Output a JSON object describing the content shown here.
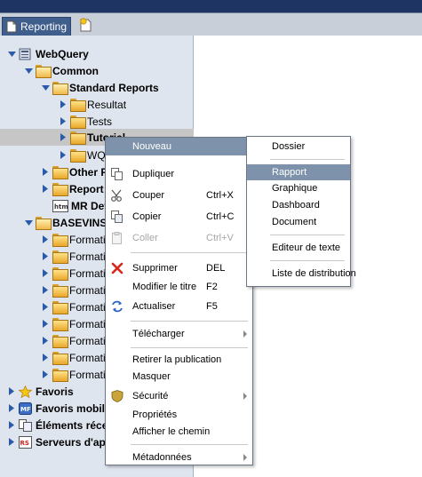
{
  "window": {
    "tab_label": "Reporting"
  },
  "tree": {
    "items": [
      {
        "label": "WebQuery",
        "icon": "webquery-icon"
      },
      {
        "label": "Common",
        "icon": "folder-open-icon"
      },
      {
        "label": "Standard Reports",
        "icon": "folder-open-icon"
      },
      {
        "label": "Resultat",
        "icon": "folder-icon"
      },
      {
        "label": "Tests",
        "icon": "folder-icon"
      },
      {
        "label": "Tutorial",
        "icon": "folder-icon"
      },
      {
        "label": "WQ",
        "icon": "folder-icon"
      },
      {
        "label": "Other R",
        "icon": "folder-icon"
      },
      {
        "label": "Report",
        "icon": "folder-icon"
      },
      {
        "label": "MR Def",
        "icon": "html-file-icon"
      },
      {
        "label": "BASEVINS",
        "icon": "folder-open-icon"
      },
      {
        "label": "Formatio",
        "icon": "folder-icon"
      },
      {
        "label": "Formatio",
        "icon": "folder-icon"
      },
      {
        "label": "Formatio",
        "icon": "folder-icon"
      },
      {
        "label": "Formatio",
        "icon": "folder-icon"
      },
      {
        "label": "Formatio",
        "icon": "folder-icon"
      },
      {
        "label": "Formatio",
        "icon": "folder-icon"
      },
      {
        "label": "Formatio",
        "icon": "folder-icon"
      },
      {
        "label": "Formatio",
        "icon": "folder-icon"
      },
      {
        "label": "Formatio",
        "icon": "folder-icon"
      },
      {
        "label": "Favoris",
        "icon": "star-icon"
      },
      {
        "label": "Favoris mobile",
        "icon": "mobile-favorites-icon"
      },
      {
        "label": "Éléments réce",
        "icon": "recent-items-icon"
      },
      {
        "label": "Serveurs d'ap",
        "icon": "servers-icon"
      }
    ]
  },
  "context_menu": {
    "items": [
      {
        "label": "Nouveau",
        "shortcut": "",
        "submenu": true
      },
      {
        "label": "Dupliquer",
        "shortcut": ""
      },
      {
        "label": "Couper",
        "shortcut": "Ctrl+X"
      },
      {
        "label": "Copier",
        "shortcut": "Ctrl+C"
      },
      {
        "label": "Coller",
        "shortcut": "Ctrl+V"
      },
      {
        "label": "Supprimer",
        "shortcut": "DEL"
      },
      {
        "label": "Modifier le titre",
        "shortcut": "F2"
      },
      {
        "label": "Actualiser",
        "shortcut": "F5"
      },
      {
        "label": "Télécharger",
        "shortcut": "",
        "submenu": true
      },
      {
        "label": "Retirer la publication",
        "shortcut": ""
      },
      {
        "label": "Masquer",
        "shortcut": ""
      },
      {
        "label": "Sécurité",
        "shortcut": "",
        "submenu": true
      },
      {
        "label": "Propriétés",
        "shortcut": ""
      },
      {
        "label": "Afficher le chemin",
        "shortcut": ""
      },
      {
        "label": "Métadonnées",
        "shortcut": "",
        "submenu": true
      }
    ]
  },
  "submenu": {
    "items": [
      {
        "label": "Dossier"
      },
      {
        "label": "Rapport"
      },
      {
        "label": "Graphique"
      },
      {
        "label": "Dashboard"
      },
      {
        "label": "Document"
      },
      {
        "label": "Editeur de texte"
      },
      {
        "label": "Liste de distribution"
      }
    ]
  },
  "colors": {
    "highlight": "#7e93ab",
    "tree_bg": "#dfe5ee",
    "top_bar": "#1e3462"
  }
}
